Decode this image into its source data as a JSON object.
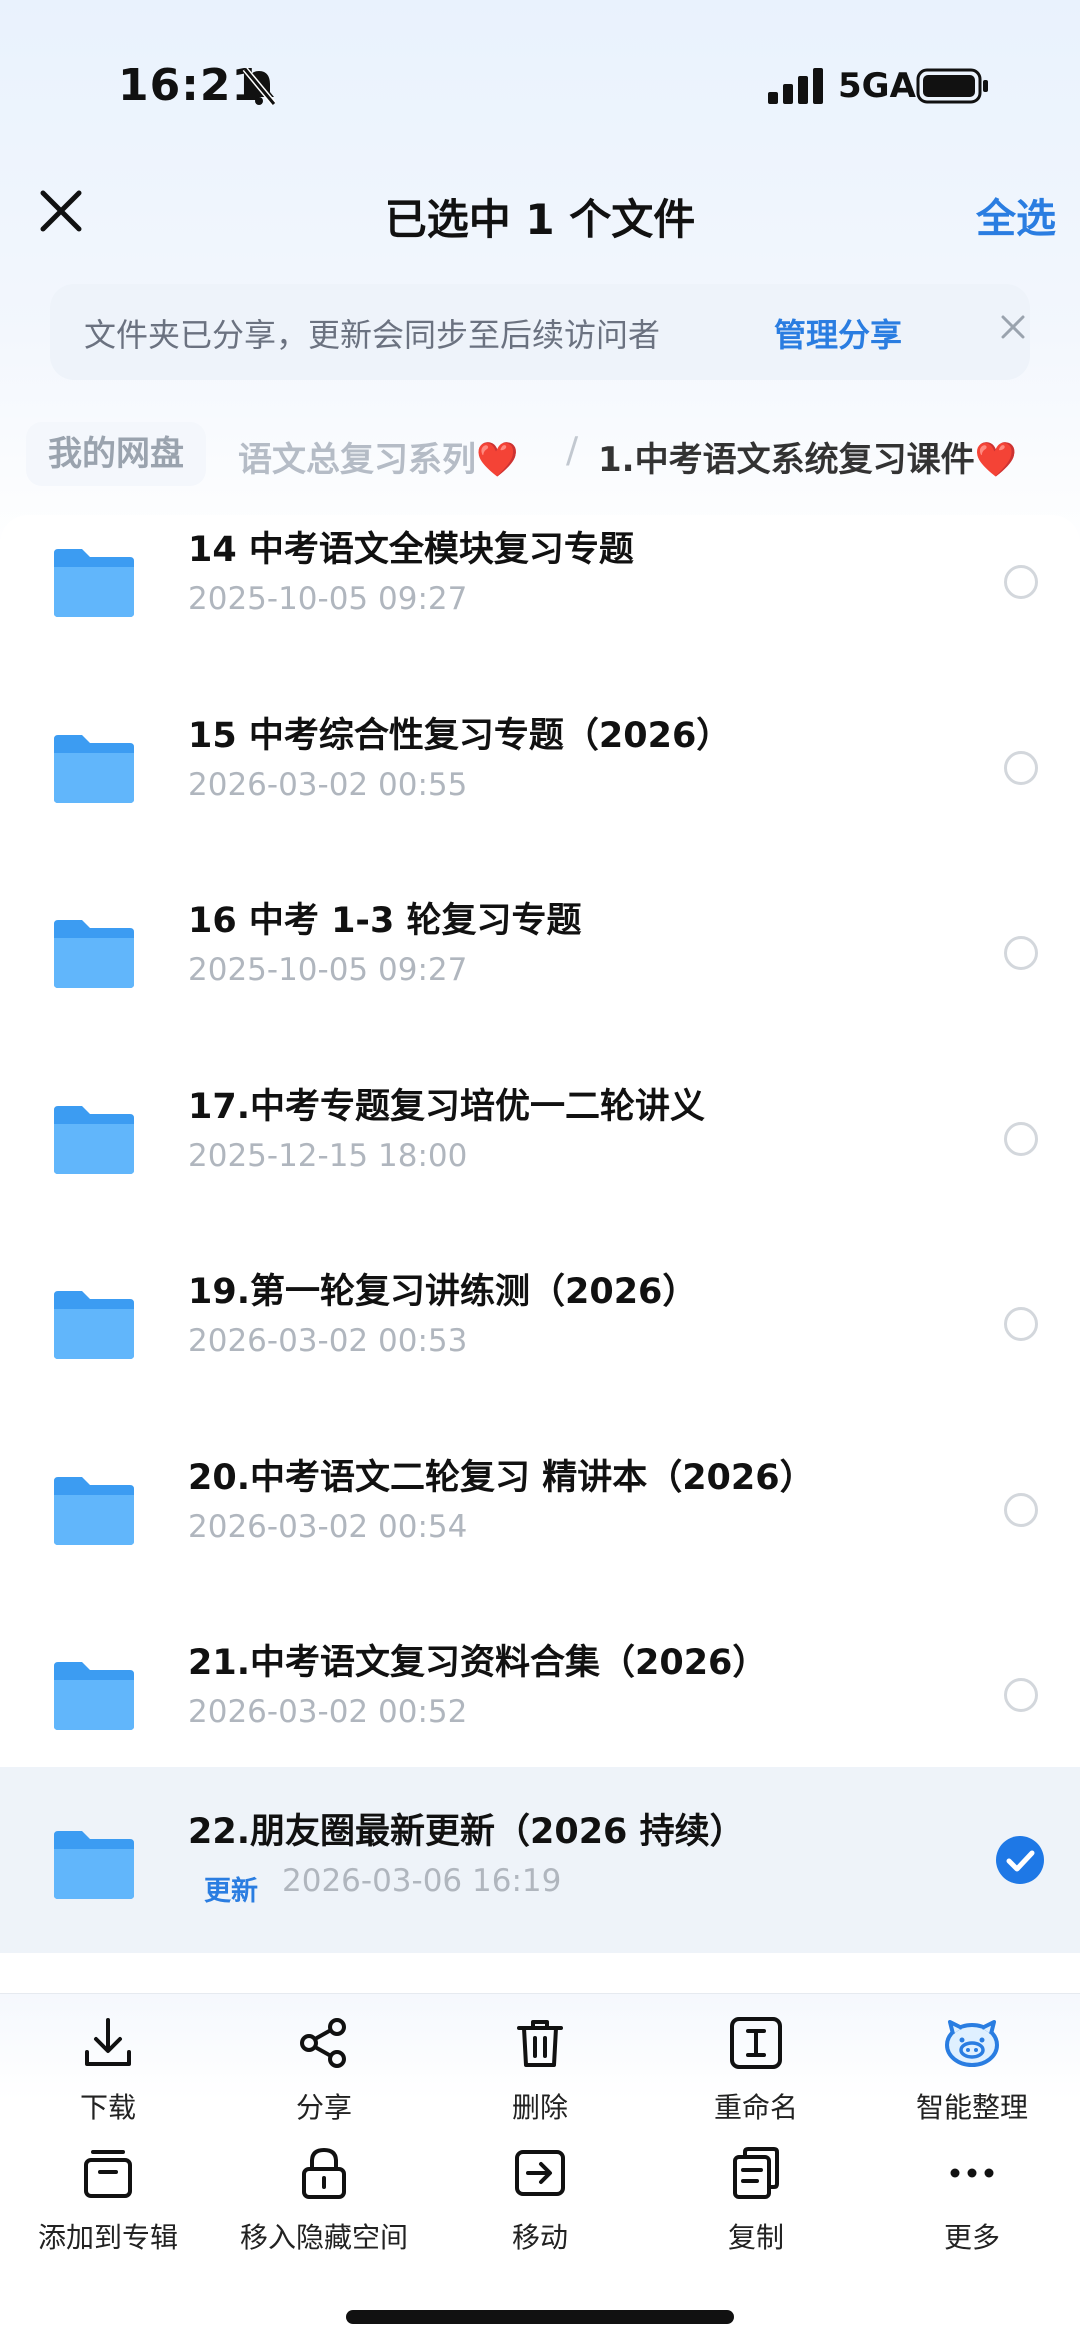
{
  "status_bar": {
    "time": "16:21",
    "network": "5GA"
  },
  "header": {
    "title": "已选中 1 个文件",
    "select_all": "全选"
  },
  "notice": {
    "text": "文件夹已分享，更新会同步至后续访问者",
    "link": "管理分享"
  },
  "breadcrumb": {
    "root": "我的网盘",
    "middle": "语文总复习系列",
    "separator": "/",
    "current": "1.中考语文系统复习课件",
    "heart": "❤️"
  },
  "files": [
    {
      "name": "14 中考语文全模块复习专题",
      "date": "2025-10-05 09:27",
      "tag": "",
      "selected": false
    },
    {
      "name": "15 中考综合性复习专题（2026）",
      "date": "2026-03-02 00:55",
      "tag": "",
      "selected": false
    },
    {
      "name": "16 中考 1-3 轮复习专题",
      "date": "2025-10-05 09:27",
      "tag": "",
      "selected": false
    },
    {
      "name": "17.中考专题复习培优一二轮讲义",
      "date": "2025-12-15 18:00",
      "tag": "",
      "selected": false
    },
    {
      "name": "19.第一轮复习讲练测（2026）",
      "date": "2026-03-02 00:53",
      "tag": "",
      "selected": false
    },
    {
      "name": "20.中考语文二轮复习 精讲本（2026）",
      "date": "2026-03-02 00:54",
      "tag": "",
      "selected": false
    },
    {
      "name": "21.中考语文复习资料合集（2026）",
      "date": "2026-03-02 00:52",
      "tag": "",
      "selected": false
    },
    {
      "name": "22.朋友圈最新更新（2026 持续）",
      "date": "2026-03-06 16:19",
      "tag": "更新",
      "selected": true
    }
  ],
  "toolbar": {
    "row1": [
      {
        "label": "下载",
        "icon": "download-icon"
      },
      {
        "label": "分享",
        "icon": "share-icon"
      },
      {
        "label": "删除",
        "icon": "trash-icon"
      },
      {
        "label": "重命名",
        "icon": "rename-icon"
      },
      {
        "label": "智能整理",
        "icon": "smart-organize-icon"
      }
    ],
    "row2": [
      {
        "label": "添加到专辑",
        "icon": "album-icon"
      },
      {
        "label": "移入隐藏空间",
        "icon": "lock-icon"
      },
      {
        "label": "移动",
        "icon": "move-icon"
      },
      {
        "label": "复制",
        "icon": "copy-icon"
      },
      {
        "label": "更多",
        "icon": "more-icon"
      }
    ]
  },
  "colors": {
    "accent": "#2a7de1",
    "folder": "#4aa8f5",
    "selected_bg": "#eef3f9"
  }
}
